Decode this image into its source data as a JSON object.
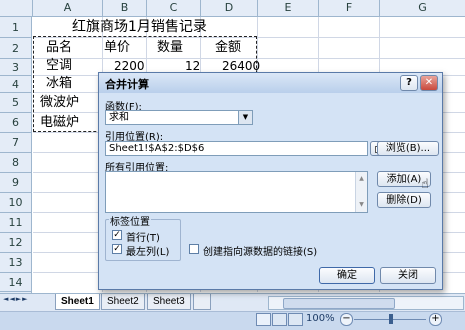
{
  "sheet": {
    "columns": [
      "A",
      "B",
      "C",
      "D",
      "E",
      "F",
      "G"
    ],
    "rows": [
      "1",
      "2",
      "3",
      "4",
      "5",
      "6",
      "7",
      "8",
      "9",
      "10",
      "11",
      "12",
      "13",
      "14",
      "15"
    ],
    "title": "红旗商场1月销售记录",
    "headers": [
      "品名",
      "单价",
      "数量",
      "金额"
    ],
    "r3": {
      "a": "空调",
      "b": "2200",
      "c": "12",
      "d": "26400"
    },
    "r4": {
      "a": "冰箱"
    },
    "r5": {
      "a": "微波炉"
    },
    "r6": {
      "a": "电磁炉"
    }
  },
  "tabs": [
    "Sheet1",
    "Sheet2",
    "Sheet3"
  ],
  "nav_arrows": [
    "◄",
    "◄",
    "►",
    "►"
  ],
  "status": {
    "zoom": "100%"
  },
  "dialog": {
    "title": "合并计算",
    "help": "?",
    "close": "✕",
    "function_label": "函数(F):",
    "function_value": "求和",
    "reference_label": "引用位置(R):",
    "reference_value": "Sheet1!$A$2:$D$6",
    "browse_button": "浏览(B)...",
    "all_refs_label": "所有引用位置:",
    "add_button": "添加(A)",
    "delete_button": "删除(D)",
    "label_group": "标签位置",
    "first_row": "首行(T)",
    "left_column": "最左列(L)",
    "link_source": "创建指向源数据的链接(S)",
    "ok_button": "确定",
    "close_button": "关闭"
  }
}
